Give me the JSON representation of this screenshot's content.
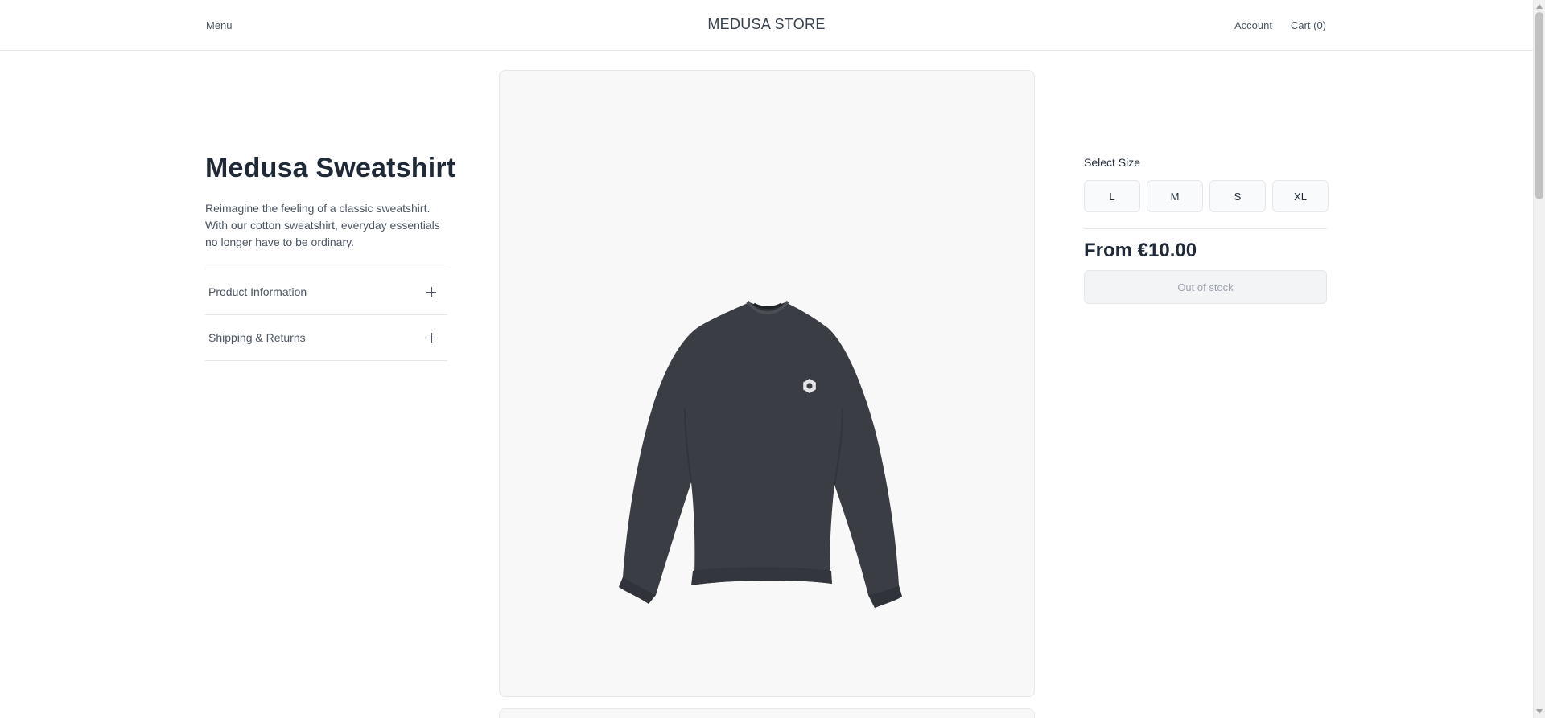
{
  "header": {
    "menu_label": "Menu",
    "store_name": "MEDUSA STORE",
    "account_label": "Account",
    "cart_label": "Cart (0)"
  },
  "product": {
    "title": "Medusa Sweatshirt",
    "description": "Reimagine the feeling of a classic sweatshirt. With our cotton sweatshirt, everyday essentials no longer have to be ordinary.",
    "accordion": [
      {
        "label": "Product Information",
        "icon": "plus-icon"
      },
      {
        "label": "Shipping & Returns",
        "icon": "plus-icon"
      }
    ],
    "image_alt": "Medusa Sweatshirt"
  },
  "purchase": {
    "select_size_label": "Select Size",
    "sizes": [
      "L",
      "M",
      "S",
      "XL"
    ],
    "price": "From €10.00",
    "stock_button_label": "Out of stock"
  },
  "colors": {
    "sweatshirt": "#3a3d43",
    "card_bg": "#f8f8f9",
    "border": "#e5e7eb",
    "disabled_text": "#9ca3af"
  }
}
